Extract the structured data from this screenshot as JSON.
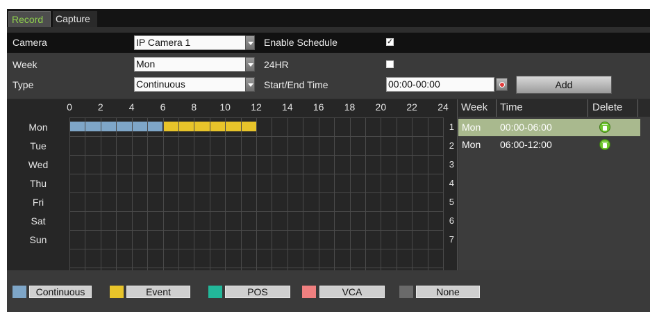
{
  "tabs": [
    {
      "label": "Record",
      "active": true
    },
    {
      "label": "Capture",
      "active": false
    }
  ],
  "camera": {
    "label": "Camera",
    "value": "IP Camera 1",
    "enable_schedule_label": "Enable Schedule",
    "enable_schedule_checked": true
  },
  "week": {
    "label": "Week",
    "value": "Mon"
  },
  "hr24": {
    "label": "24HR",
    "checked": false
  },
  "type": {
    "label": "Type",
    "value": "Continuous"
  },
  "start_end": {
    "label": "Start/End Time",
    "value": "00:00-00:00"
  },
  "add_label": "Add",
  "hours": [
    "0",
    "2",
    "4",
    "6",
    "8",
    "10",
    "12",
    "14",
    "16",
    "18",
    "20",
    "22",
    "24"
  ],
  "days": [
    "Mon",
    "Tue",
    "Wed",
    "Thu",
    "Fri",
    "Sat",
    "Sun"
  ],
  "row_numbers": [
    "1",
    "2",
    "3",
    "4",
    "5",
    "6",
    "7"
  ],
  "schedule": [
    {
      "day": "Mon",
      "start": 0,
      "end": 6,
      "type": "Continuous"
    },
    {
      "day": "Mon",
      "start": 6,
      "end": 12,
      "type": "Event"
    }
  ],
  "table": {
    "headers": {
      "week": "Week",
      "time": "Time",
      "delete": "Delete"
    },
    "rows": [
      {
        "week": "Mon",
        "time": "00:00-06:00",
        "selected": true
      },
      {
        "week": "Mon",
        "time": "06:00-12:00",
        "selected": false
      }
    ]
  },
  "legend": [
    {
      "label": "Continuous",
      "color": "#7ea6c8"
    },
    {
      "label": "Event",
      "color": "#e8c42a"
    },
    {
      "label": "POS",
      "color": "#22b89a"
    },
    {
      "label": "VCA",
      "color": "#f08080"
    },
    {
      "label": "None",
      "color": "#6a6a6a"
    }
  ],
  "colors": {
    "continuous": "#7ea6c8",
    "event": "#e8c42a",
    "selected_row": "#a9b98e",
    "active_tab_text": "#8fd14d"
  }
}
